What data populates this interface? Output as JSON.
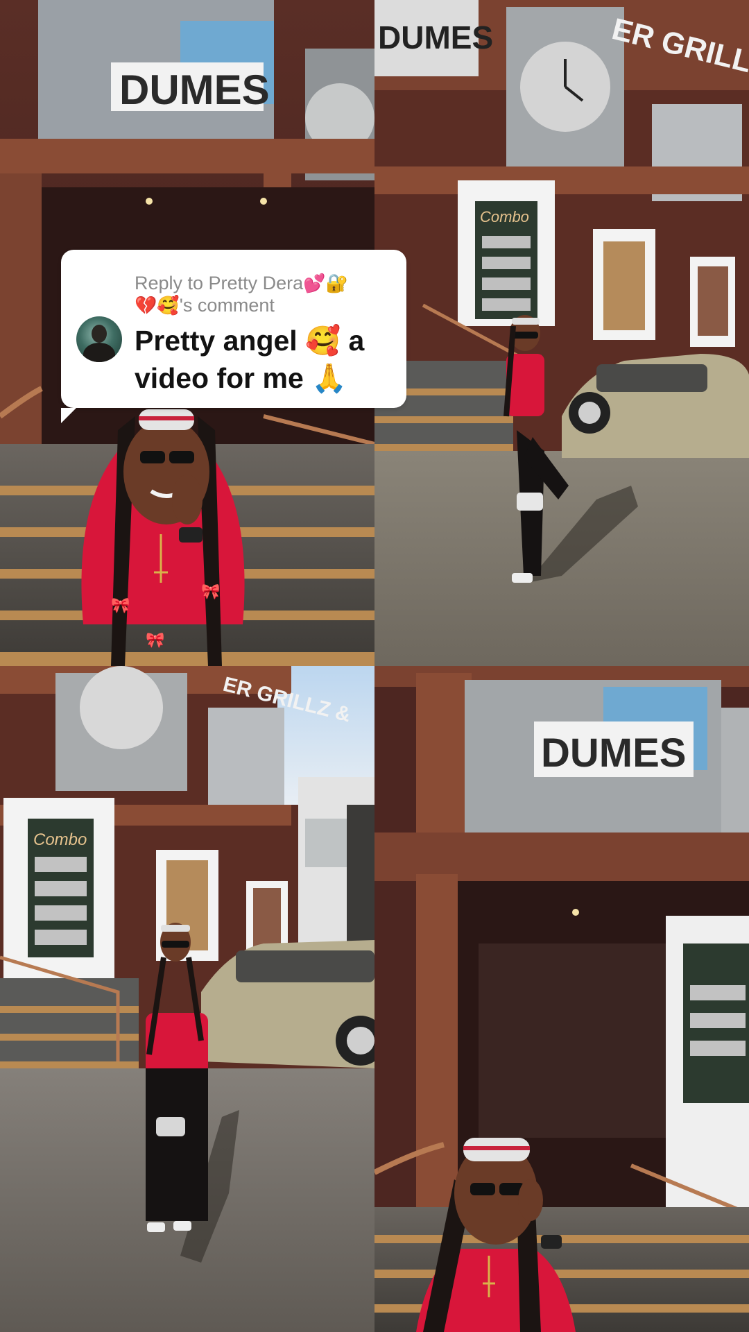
{
  "reply": {
    "prefix": "Reply to Pretty Dera",
    "name_emojis": "💕🔐",
    "line2_emojis": "💔🥰",
    "suffix": "'s comment",
    "text_part1": "Pretty angel ",
    "text_part1_emoji": "🥰",
    "text_part2": " a video for me ",
    "text_part2_emoji": "🙏"
  },
  "photos": {
    "sign_dumes": "DUMES",
    "sign_grillz": "ER GRILLZ &",
    "poster_title": "Combo"
  },
  "colors": {
    "bubble_bg": "#ffffff",
    "reply_meta": "#8a8a8a",
    "reply_text": "#121212",
    "shirt_red": "#d8163a",
    "building_brown": "#6e3a2c"
  }
}
